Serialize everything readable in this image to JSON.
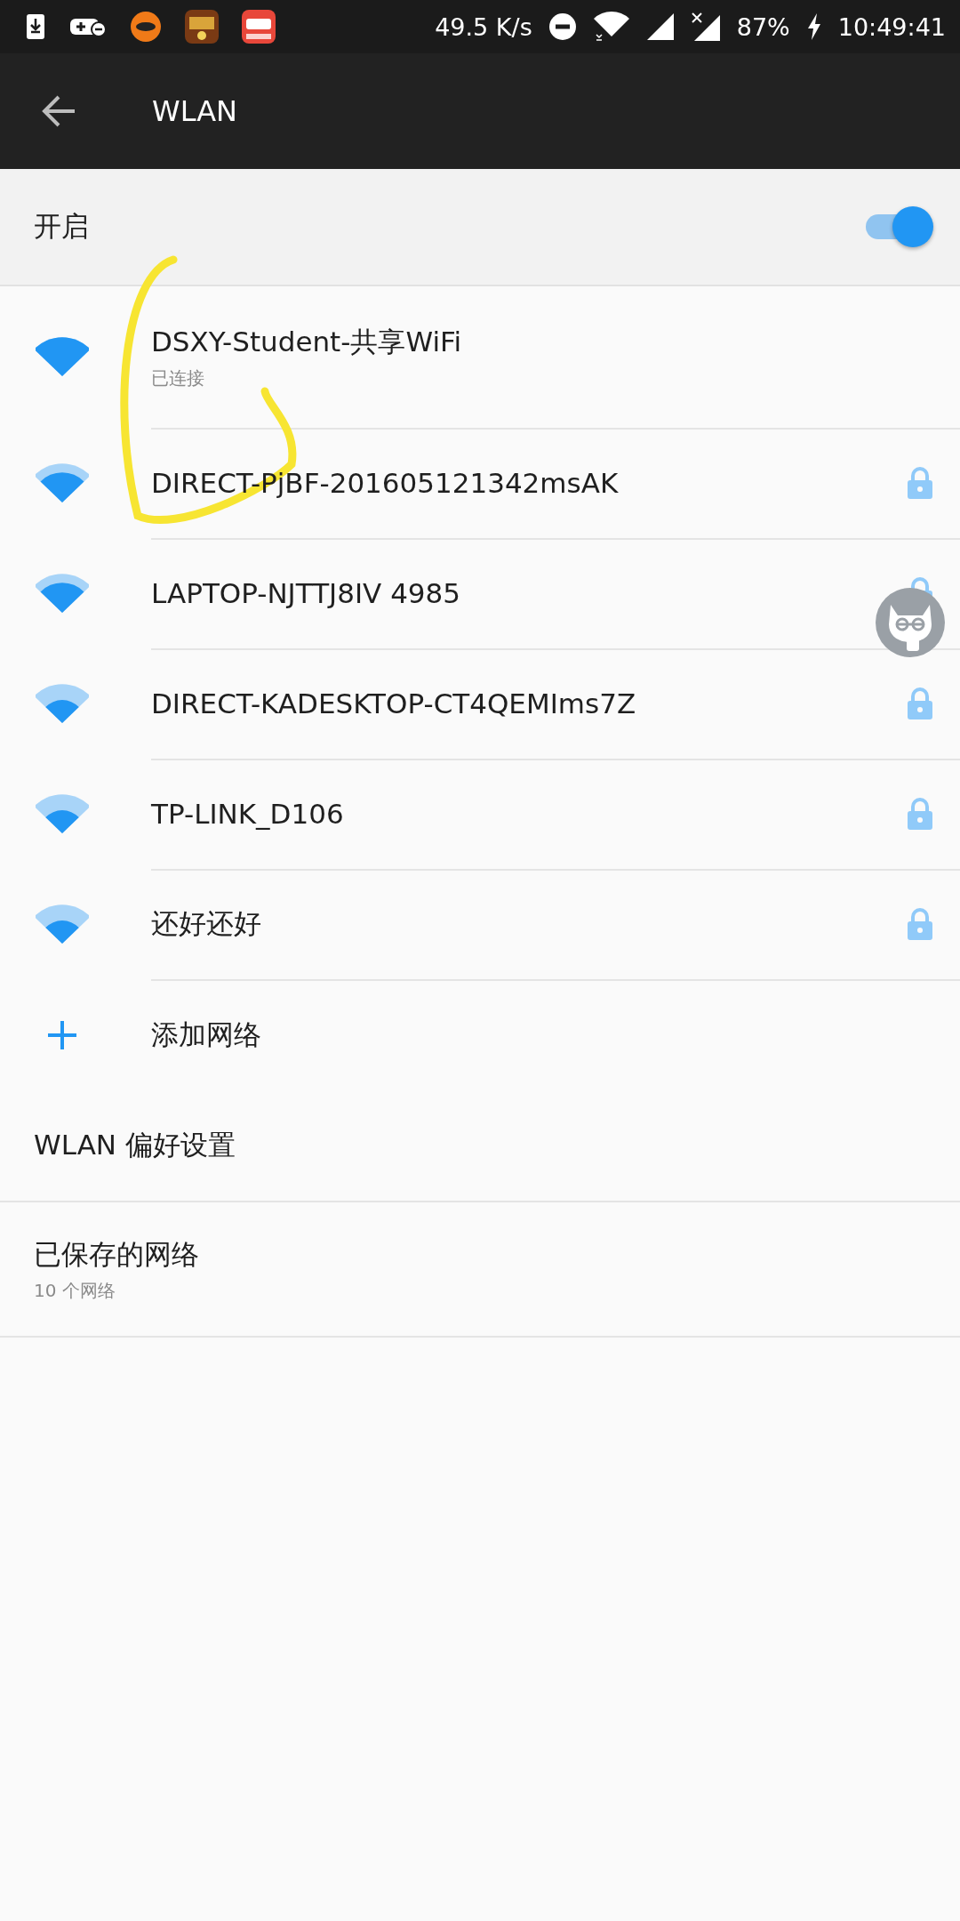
{
  "status_bar": {
    "speed": "49.5 K/s",
    "battery": "87%",
    "time": "10:49:41"
  },
  "toolbar": {
    "title": "WLAN"
  },
  "master_switch": {
    "label": "开启",
    "on": true
  },
  "networks": [
    {
      "name": "DSXY-Student-共享WiFi",
      "status": "已连接",
      "kind": "full",
      "locked": false
    },
    {
      "name": "DIRECT-PjBF-201605121342msAK",
      "kind": "good",
      "locked": true
    },
    {
      "name": "LAPTOP-NJTTJ8IV 4985",
      "kind": "good",
      "locked": true
    },
    {
      "name": "DIRECT-KADESKTOP-CT4QEMIms7Z",
      "kind": "fair",
      "locked": true
    },
    {
      "name": "TP-LINK_D106",
      "kind": "fair",
      "locked": true
    },
    {
      "name": "还好还好",
      "kind": "fair",
      "locked": true
    }
  ],
  "add_network": {
    "label": "添加网络"
  },
  "preferences": {
    "label": "WLAN 偏好设置"
  },
  "saved_networks": {
    "label": "已保存的网络",
    "summary": "10 个网络"
  }
}
